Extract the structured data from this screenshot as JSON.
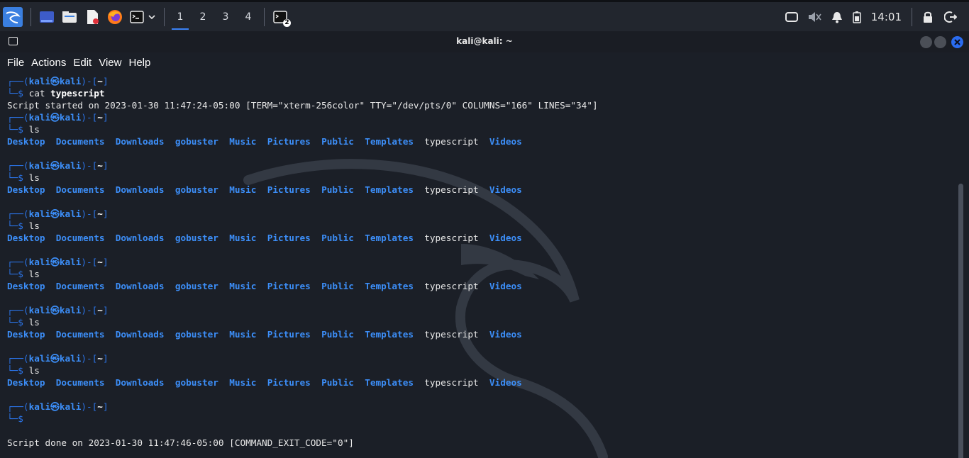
{
  "taskbar": {
    "workspaces": [
      "1",
      "2",
      "3",
      "4"
    ],
    "clock": "14:01",
    "terminal_badge": "2"
  },
  "window": {
    "title": "kali@kali: ~",
    "menu": [
      "File",
      "Actions",
      "Edit",
      "View",
      "Help"
    ]
  },
  "terminal": {
    "prompt_user": "kali",
    "prompt_at": "㉿",
    "prompt_host": "kali",
    "prompt_dir": "~",
    "first_command": "cat",
    "first_arg": "typescript",
    "script_started": "Script started on 2023-01-30 11:47:24-05:00 [TERM=\"xterm-256color\" TTY=\"/dev/pts/0\" COLUMNS=\"166\" LINES=\"34\"]",
    "ls_command": "ls",
    "listing": [
      {
        "name": "Desktop",
        "type": "dir"
      },
      {
        "name": "Documents",
        "type": "dir"
      },
      {
        "name": "Downloads",
        "type": "dir"
      },
      {
        "name": "gobuster",
        "type": "dir"
      },
      {
        "name": "Music",
        "type": "dir"
      },
      {
        "name": "Pictures",
        "type": "dir"
      },
      {
        "name": "Public",
        "type": "dir"
      },
      {
        "name": "Templates",
        "type": "dir"
      },
      {
        "name": "typescript",
        "type": "file"
      },
      {
        "name": "Videos",
        "type": "dir"
      }
    ],
    "script_done": "Script done on 2023-01-30 11:47:46-05:00 [COMMAND_EXIT_CODE=\"0\"]"
  },
  "colors": {
    "accent": "#3c8ef8",
    "background": "#1b1f27",
    "close_button": "#2a6cf0"
  }
}
